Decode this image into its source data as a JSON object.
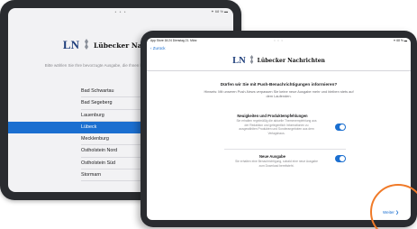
{
  "back_screen": {
    "status_dots": "• • •",
    "status_right": "✦ 68 % ▬",
    "brand": {
      "logo": "LN",
      "name": "Lübecker Nachrichten"
    },
    "subtitle": "Bitte wählen Sie Ihre bevorzugte Ausgabe, die Ihnen beim Start der App angezeigt wird.",
    "regions": [
      {
        "label": "Bad Schwartau",
        "selected": false
      },
      {
        "label": "Bad Segeberg",
        "selected": false
      },
      {
        "label": "Lauenburg",
        "selected": false
      },
      {
        "label": "Lübeck",
        "selected": true
      },
      {
        "label": "Mecklenburg",
        "selected": false
      },
      {
        "label": "Ostholstein Nord",
        "selected": false
      },
      {
        "label": "Ostholstein Süd",
        "selected": false
      },
      {
        "label": "Stormarn",
        "selected": false
      }
    ]
  },
  "front_screen": {
    "status": {
      "left": "App Store 16:24 Dienstag 21. März",
      "dots": "• • •",
      "right": "✦ 68 % ▬"
    },
    "back_link": "Zurück",
    "brand": {
      "logo": "LN",
      "name": "Lübecker Nachrichten"
    },
    "question": "Dürfen wir Sie mit Push-Benachrichtigungen informieren?",
    "explain": "Hinweis: Mit unseren Push-News verpassen Sie keine neue Ausgabe mehr und bleiben stets auf dem Laufenden.",
    "options": [
      {
        "title": "Neuigkeiten und Produktempfehlungen",
        "desc": "Sie erhalten regelmäßig die aktuelle Themenempfehlung aus der Redaktion und gelegentlich Informationen zu ausgewählten Produkten und Sonderangeboten aus dem Verlagshaus.",
        "enabled": true
      },
      {
        "title": "Neue Ausgabe",
        "desc": "Sie erhalten eine Benachrichtigung, sobald eine neue Ausgabe zum Download bereitsteht.",
        "enabled": true
      }
    ],
    "next_button": "Weiter ❯"
  },
  "colors": {
    "accent": "#1b6fd0",
    "highlight": "#f07a28",
    "brand_blue": "#1d3d7a"
  }
}
